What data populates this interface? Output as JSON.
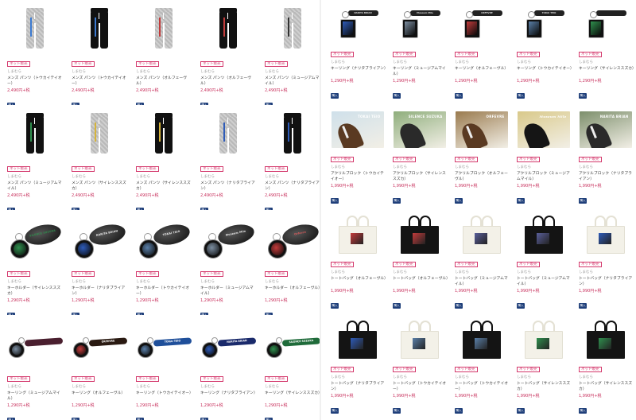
{
  "badge_label": "ネット販売",
  "shop_name": "しまむら",
  "cart_label": "購入",
  "left_panel": {
    "rows": [
      {
        "kind": "pants",
        "items": [
          {
            "title": "メンズ パンツ（トウカイテイオー）",
            "price": "2,490円+税",
            "variant": "gray",
            "stripe": "#3d7bd1"
          },
          {
            "title": "メンズ パンツ（トウカイテイオー）",
            "price": "2,490円+税",
            "variant": "black",
            "stripe": "#3d7bd1"
          },
          {
            "title": "メンズ パンツ（オルフェーヴル）",
            "price": "2,490円+税",
            "variant": "gray",
            "stripe": "#c23b3b"
          },
          {
            "title": "メンズ パンツ（オルフェーヴル）",
            "price": "2,490円+税",
            "variant": "black",
            "stripe": "#c23b3b"
          },
          {
            "title": "メンズ パンツ（ミュージアムマイル）",
            "price": "2,490円+税",
            "variant": "gray",
            "stripe": "#333333"
          }
        ]
      },
      {
        "kind": "pants",
        "items": [
          {
            "title": "メンズ パンツ（ミュージアムマイル）",
            "price": "2,490円+税",
            "variant": "black",
            "stripe": "#2f8f4e"
          },
          {
            "title": "メンズ パンツ（サイレンススズカ）",
            "price": "2,490円+税",
            "variant": "gray",
            "stripe": "#d6b43a"
          },
          {
            "title": "メンズ パンツ（サイレンススズカ）",
            "price": "2,490円+税",
            "variant": "black",
            "stripe": "#d6b43a"
          },
          {
            "title": "メンズ パンツ（ナリタブライアン）",
            "price": "2,490円+税",
            "variant": "gray",
            "stripe": "#2e5bb8"
          },
          {
            "title": "メンズ パンツ（ナリタブライアン）",
            "price": "2,490円+税",
            "variant": "black",
            "stripe": "#2e5bb8"
          }
        ]
      },
      {
        "kind": "oval-keychain",
        "items": [
          {
            "title": "キーホルダー（サイレンススズカ）",
            "price": "1,290円+税",
            "tab_text": "SILENCE SUZUKA",
            "accent": "#2f8f4e",
            "tab_color": "#2f8f4e"
          },
          {
            "title": "キーホルダー（ナリタブライアン）",
            "price": "1,290円+税",
            "tab_text": "NARITA BRIAN",
            "accent": "#2e5bb8",
            "tab_color": "#eeeeee"
          },
          {
            "title": "キーホルダー（トウカイテイオー）",
            "price": "1,290円+税",
            "tab_text": "TOKAI TEIO",
            "accent": "#5a7fa8",
            "tab_color": "#eeeeee"
          },
          {
            "title": "キーホルダー（ミュージアムマイル）",
            "price": "1,290円+税",
            "tab_text": "Museum Mile",
            "accent": "#7b8da0",
            "tab_color": "#eeeeee"
          },
          {
            "title": "キーホルダー（オルフェーヴル）",
            "price": "1,290円+税",
            "tab_text": "Orfevre",
            "accent": "#c23b3b",
            "tab_color": "#e05a5a"
          }
        ]
      },
      {
        "kind": "strap-keychain",
        "items": [
          {
            "title": "キーリング（ミュージアムマイル）",
            "price": "1,290円+税",
            "band_text": "",
            "band_color": "#4a1f2f",
            "accent": "#7b8da0"
          },
          {
            "title": "キーリング（オルフェーヴル）",
            "price": "1,290円+税",
            "band_text": "ORFEVRE",
            "band_color": "#2a1a12",
            "accent": "#c23b3b"
          },
          {
            "title": "キーリング（トウカイテイオー）",
            "price": "1,290円+税",
            "band_text": "TOKAI TEIO",
            "band_color": "#1f4f9a",
            "accent": "#5a7fa8"
          },
          {
            "title": "キーリング（ナリタブライアン）",
            "price": "1,290円+税",
            "band_text": "NARITA BRIAN",
            "band_color": "#1a2a6b",
            "accent": "#2e5bb8"
          },
          {
            "title": "キーリング（サイレンススズカ）",
            "price": "1,290円+税",
            "band_text": "SILENCE SUZUKA",
            "band_color": "#1f6b3a",
            "accent": "#2f8f4e"
          }
        ]
      }
    ]
  },
  "right_panel": {
    "rows": [
      {
        "kind": "square-keychain",
        "items": [
          {
            "title": "キーリング（ナリタブライアン）",
            "price": "1,290円+税",
            "strap_text": "NARITA BRIAN",
            "accent": "#2e5bb8"
          },
          {
            "title": "キーリング（ミュージアムマイル）",
            "price": "1,290円+税",
            "strap_text": "Museum Mile",
            "accent": "#7b8da0"
          },
          {
            "title": "キーリング（オルフェーヴル）",
            "price": "1,290円+税",
            "strap_text": "ORFEVRE",
            "accent": "#c23b3b"
          },
          {
            "title": "キーリング（トウカイテイオー）",
            "price": "1,290円+税",
            "strap_text": "TOKAI TEIO",
            "accent": "#5a7fa8"
          },
          {
            "title": "キーリング（サイレンススズカ）",
            "price": "1,290円+税",
            "strap_text": "",
            "accent": "#2f8f4e"
          }
        ]
      },
      {
        "kind": "acrylic-block",
        "items": [
          {
            "title": "アクリルブロック（トウカイテイオー）",
            "price": "1,990円+税",
            "label": "TOKAI TEIO",
            "bg": "#cfe0ea",
            "horse": "brown",
            "label_style": "light",
            "blaze": true,
            "slash": false
          },
          {
            "title": "アクリルブロック（サイレンススズカ）",
            "price": "1,990円+税",
            "label": "SILENCE SUZUKA",
            "bg": "#8fae7c",
            "horse": "dark",
            "label_style": "light",
            "blaze": false,
            "slash": false
          },
          {
            "title": "アクリルブロック（オルフェーヴル）",
            "price": "1,990円+税",
            "label": "ORFEVRE",
            "bg": "#9a7b4f",
            "horse": "brown",
            "label_style": "light",
            "blaze": true,
            "slash": false
          },
          {
            "title": "アクリルブロック（ミュージアムマイル）",
            "price": "1,990円+税",
            "label": "Museum Mile",
            "bg": "#d9c98a",
            "horse": "black",
            "label_style": "script",
            "blaze": false,
            "slash": false
          },
          {
            "title": "アクリルブロック（ナリタブライアン）",
            "price": "1,990円+税",
            "label": "NARITA BRIAN",
            "bg": "#7d8f6c",
            "horse": "dark",
            "label_style": "light",
            "blaze": true,
            "slash": true
          }
        ]
      },
      {
        "kind": "tote",
        "items": [
          {
            "title": "トートバッグ（オルフェーヴル）",
            "price": "1,990円+税",
            "variant": "white",
            "print": "#c23b3b"
          },
          {
            "title": "トートバッグ（オルフェーヴル）",
            "price": "1,990円+税",
            "variant": "black",
            "print": "#c23b3b"
          },
          {
            "title": "トートバッグ（ミュージアムマイル）",
            "price": "1,990円+税",
            "variant": "white",
            "print": "#5a5f9a"
          },
          {
            "title": "トートバッグ（ミュージアムマイル）",
            "price": "1,990円+税",
            "variant": "black",
            "print": "#5a5f9a"
          },
          {
            "title": "トートバッグ（ナリタブライアン）",
            "price": "1,990円+税",
            "variant": "white",
            "print": "#2e5bb8"
          }
        ]
      },
      {
        "kind": "tote",
        "items": [
          {
            "title": "トートバッグ（ナリタブライアン）",
            "price": "1,990円+税",
            "variant": "black",
            "print": "#2e5bb8"
          },
          {
            "title": "トートバッグ（トウカイテイオー）",
            "price": "1,990円+税",
            "variant": "white",
            "print": "#5a7fa8"
          },
          {
            "title": "トートバッグ（トウカイテイオー）",
            "price": "1,990円+税",
            "variant": "black",
            "print": "#5a7fa8"
          },
          {
            "title": "トートバッグ（サイレンススズカ）",
            "price": "1,990円+税",
            "variant": "white",
            "print": "#2f8f4e"
          },
          {
            "title": "トートバッグ（サイレンススズカ）",
            "price": "1,990円+税",
            "variant": "black",
            "print": "#2f8f4e"
          }
        ]
      }
    ]
  }
}
